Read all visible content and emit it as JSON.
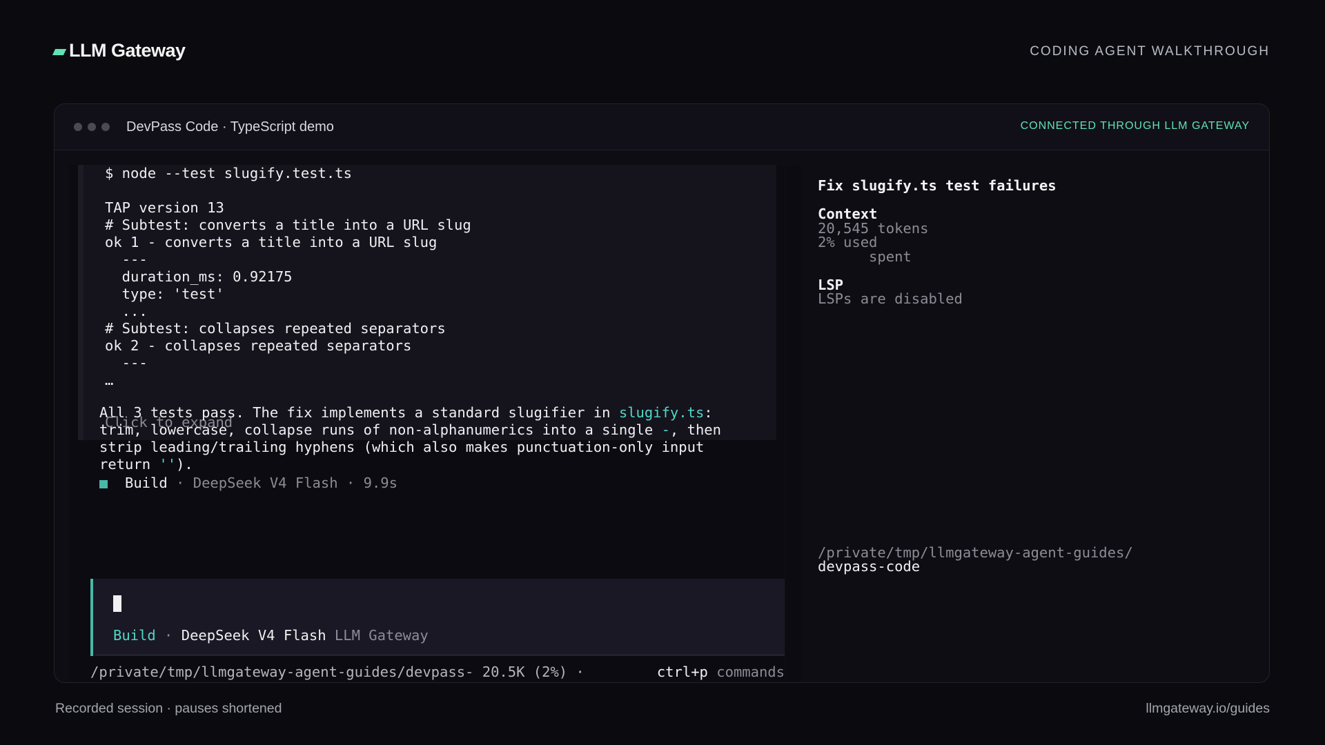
{
  "header": {
    "brand": "LLM Gateway",
    "walkthrough_label": "CODING AGENT WALKTHROUGH"
  },
  "window": {
    "title": "DevPass Code · TypeScript demo",
    "connection_status": "CONNECTED THROUGH LLM GATEWAY"
  },
  "tool_output": {
    "lines": [
      "$ node --test slugify.test.ts",
      "",
      "TAP version 13",
      "# Subtest: converts a title into a URL slug",
      "ok 1 - converts a title into a URL slug",
      "  ---",
      "  duration_ms: 0.92175",
      "  type: 'test'",
      "  ...",
      "# Subtest: collapses repeated separators",
      "ok 2 - collapses repeated separators",
      "  ---",
      "…"
    ],
    "expand_label": "Click to expand"
  },
  "assistant_message": {
    "line1_pre": "All 3 tests pass. The fix implements a standard slugifier in ",
    "line1_file": "slugify.ts",
    "line1_post": ":",
    "line2_pre": "trim, lowercase, collapse runs of non-alphanumerics into a single ",
    "line2_dash": "-",
    "line2_post": ", then",
    "line3": "strip leading/trailing hyphens (which also makes punctuation-only input",
    "line4_pre": "return ",
    "line4_quote": "''",
    "line4_post": ")."
  },
  "build_status": {
    "mode": "Build",
    "sep": " · ",
    "model": "DeepSeek V4 Flash",
    "duration": "9.9s"
  },
  "input": {
    "mode": "Build",
    "sep": " · ",
    "model": "DeepSeek V4 Flash",
    "provider": "LLM Gateway"
  },
  "status_bar": {
    "path": "/private/tmp/llmgateway-agent-guides/devpass- 20.5K (2%) ·",
    "shortcut": "ctrl+p",
    "shortcut_label": "commands"
  },
  "sidebar": {
    "session_title": "Fix slugify.ts test failures",
    "context_heading": "Context",
    "context_tokens": "20,545 tokens",
    "context_used": "2% used",
    "context_spent": "      spent",
    "lsp_heading": "LSP",
    "lsp_status": "LSPs are disabled",
    "path_line1": "/private/tmp/llmgateway-agent-guides/",
    "path_line2": "devpass-code"
  },
  "footer": {
    "left": "Recorded session · pauses shortened",
    "right": "llmgateway.io/guides"
  },
  "colors": {
    "accent": "#5fe3b4",
    "teal": "#4fd8c7",
    "background": "#0b0b0f"
  }
}
